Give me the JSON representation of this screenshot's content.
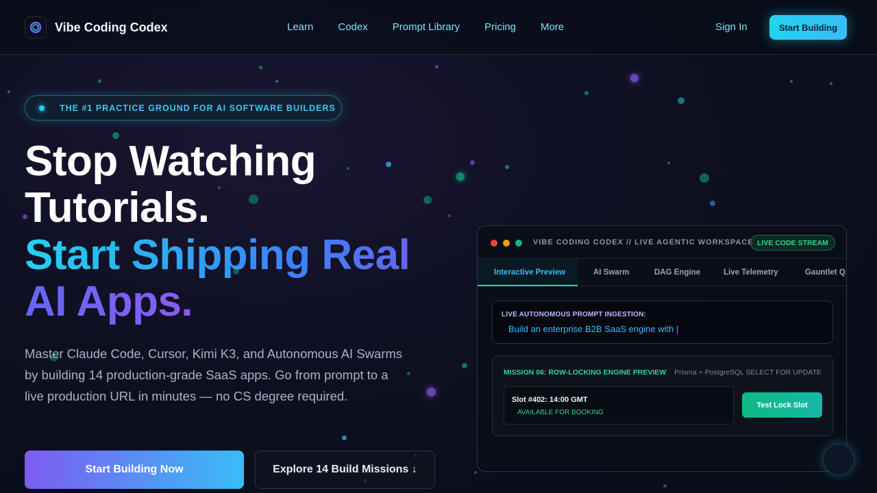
{
  "brand": {
    "name": "Vibe Coding Codex",
    "logo_icon": "orb-logo-icon"
  },
  "nav": {
    "links": [
      "Learn",
      "Codex",
      "Prompt Library",
      "Pricing",
      "More"
    ],
    "sign_in": "Sign In",
    "cta": "Start Building"
  },
  "hero": {
    "pill": "THE #1 PRACTICE GROUND FOR AI SOFTWARE BUILDERS",
    "headline_1": "Stop Watching",
    "headline_2": "Tutorials.",
    "headline_3": "Start Shipping Real",
    "headline_4": "AI Apps.",
    "subtitle": "Master Claude Code, Cursor, Kimi K3, and Autonomous AI Swarms by building 14 production-grade SaaS apps. Go from prompt to a live production URL in minutes — no CS degree required.",
    "cta_primary": "Start Building Now",
    "cta_secondary": "Explore 14 Build Missions ↓"
  },
  "workspace": {
    "title": "VIBE CODING CODEX // LIVE AGENTIC WORKSPACE",
    "badge": "LIVE CODE STREAM",
    "tabs": [
      "Interactive Preview",
      "AI Swarm",
      "DAG Engine",
      "Live Telemetry",
      "Gauntlet Q..."
    ],
    "active_tab": "Interactive Preview",
    "prompt_label": "LIVE AUTONOMOUS PROMPT INGESTION:",
    "prompt_text": "Build an enterprise B2B SaaS engine with |",
    "mission_label": "MISSION 06: ROW-LOCKING ENGINE PREVIEW",
    "mission_meta": "Prisma + PostgreSQL SELECT FOR UPDATE",
    "slot_title": "Slot #402: 14:00 GMT",
    "slot_status": "AVAILABLE FOR BOOKING",
    "lock_button": "Test Lock Slot"
  },
  "colors": {
    "accent_cyan": "#22d3ee",
    "accent_blue": "#3b82f6",
    "accent_violet": "#8b5cf6",
    "success_green": "#34d399",
    "background": "#070d17"
  }
}
